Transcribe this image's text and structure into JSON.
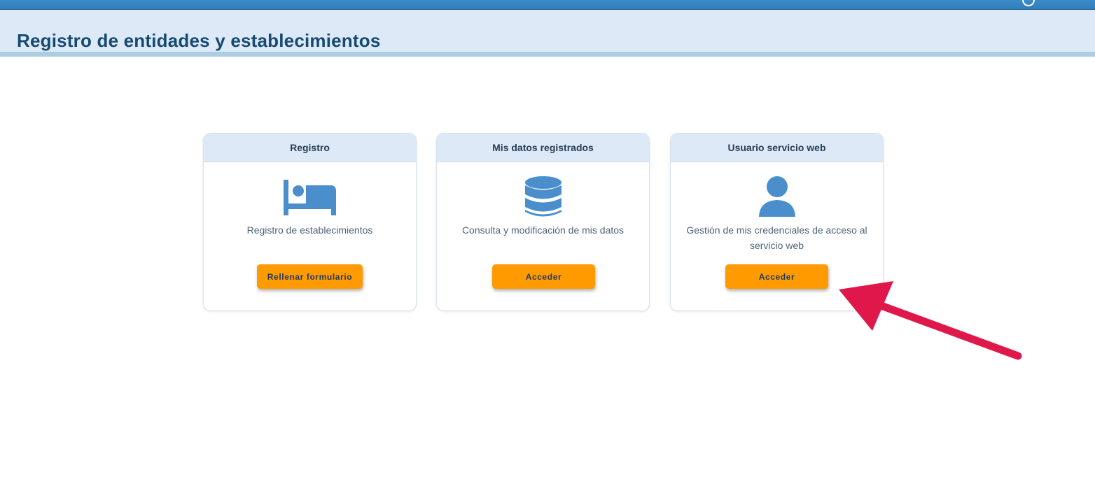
{
  "header": {
    "title": "Registro de entidades y establecimientos"
  },
  "cards": [
    {
      "title": "Registro",
      "icon": "bed-icon",
      "description": "Registro de establecimientos",
      "button_label": "Rellenar formulario"
    },
    {
      "title": "Mis datos registrados",
      "icon": "database-icon",
      "description": "Consulta y modificación de mis datos",
      "button_label": "Acceder"
    },
    {
      "title": "Usuario servicio web",
      "icon": "user-icon",
      "description": "Gestión de mis credenciales de acceso al servicio web",
      "button_label": "Acceder"
    }
  ],
  "colors": {
    "accent_button": "#ff9a00",
    "icon_blue": "#4a8fcc",
    "title_blue": "#164a72",
    "annotation_arrow": "#e0174a"
  }
}
